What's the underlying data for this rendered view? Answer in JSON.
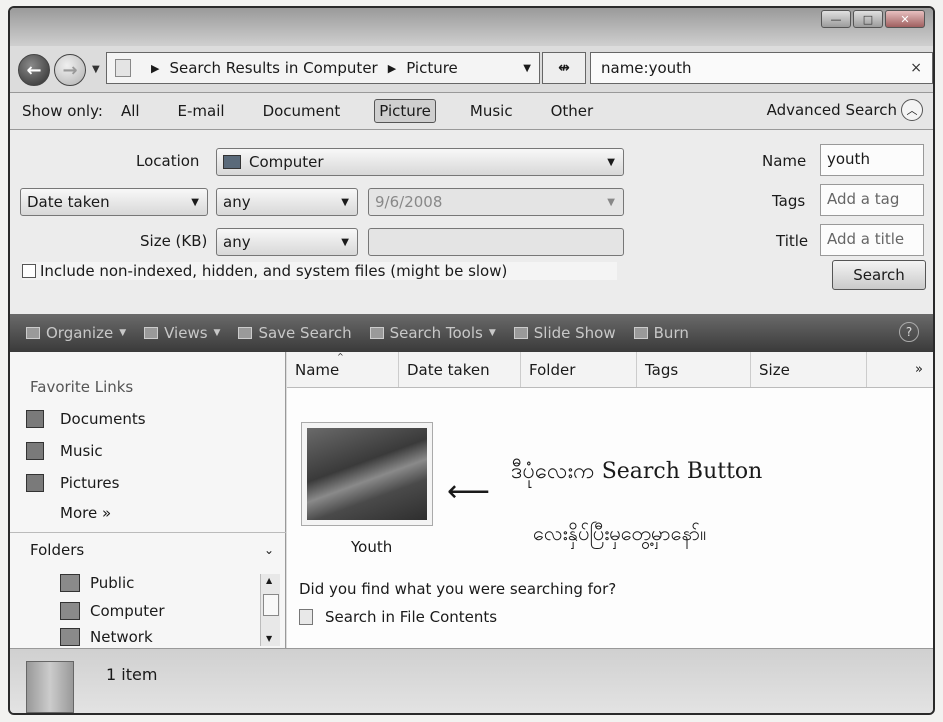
{
  "window": {
    "controls": {
      "minimize": "—",
      "maximize": "□",
      "close": "✕"
    }
  },
  "nav": {
    "back_icon": "arrow-left-icon",
    "forward_icon": "arrow-right-icon",
    "back_glyph": "←",
    "forward_glyph": "→",
    "recent_drop": "▼"
  },
  "address": {
    "crumbs": [
      "Search Results in Computer",
      "Picture"
    ],
    "separator": "▶",
    "dropdown": "▼",
    "refresh": "↮"
  },
  "search": {
    "value": "name:youth",
    "clear": "×"
  },
  "show_only": {
    "label": "Show only:",
    "filters": [
      "All",
      "E-mail",
      "Document",
      "Picture",
      "Music",
      "Other"
    ],
    "active": "Picture",
    "advanced_label": "Advanced Search",
    "advanced_toggle": "︿"
  },
  "advanced": {
    "location_label": "Location",
    "location_value": "Computer",
    "date_field": "Date taken",
    "date_op": "any",
    "date_value": "9/6/2008",
    "size_label": "Size (KB)",
    "size_op": "any",
    "size_value": "",
    "include_label": "Include non-indexed, hidden, and system files (might be slow)",
    "name_label": "Name",
    "name_value": "youth",
    "tags_label": "Tags",
    "tags_placeholder": "Add a tag",
    "title_label": "Title",
    "title_placeholder": "Add a title",
    "search_button": "Search",
    "combo_arrow": "▼"
  },
  "commands": {
    "items": [
      {
        "label": "Organize",
        "dropdown": true
      },
      {
        "label": "Views",
        "dropdown": true
      },
      {
        "label": "Save Search",
        "dropdown": false
      },
      {
        "label": "Search Tools",
        "dropdown": true
      },
      {
        "label": "Slide Show",
        "dropdown": false
      },
      {
        "label": "Burn",
        "dropdown": false
      }
    ],
    "dropdown_glyph": "▼",
    "help": "?"
  },
  "sidebar": {
    "favorites_title": "Favorite Links",
    "favorites": [
      "Documents",
      "Music",
      "Pictures"
    ],
    "more": "More »",
    "folders_title": "Folders",
    "folders_chevron": "⌄",
    "tree": [
      "Public",
      "Computer",
      "Network"
    ]
  },
  "columns": {
    "headers": [
      "Name",
      "Date taken",
      "Folder",
      "Tags",
      "Size"
    ],
    "sort_glyph": "^",
    "more": "»"
  },
  "results": {
    "items": [
      {
        "name": "Youth"
      }
    ],
    "annotation_arrow": "⟵",
    "annotation_line1": "ဒီပုံလေးက  Search Button",
    "annotation_line2": "လေးနှိပ်ပြီးမှတွေ့မှာနော်။",
    "found_question": "Did you find what you were searching for?",
    "search_contents": "Search in File Contents"
  },
  "details": {
    "count": "1 item"
  }
}
